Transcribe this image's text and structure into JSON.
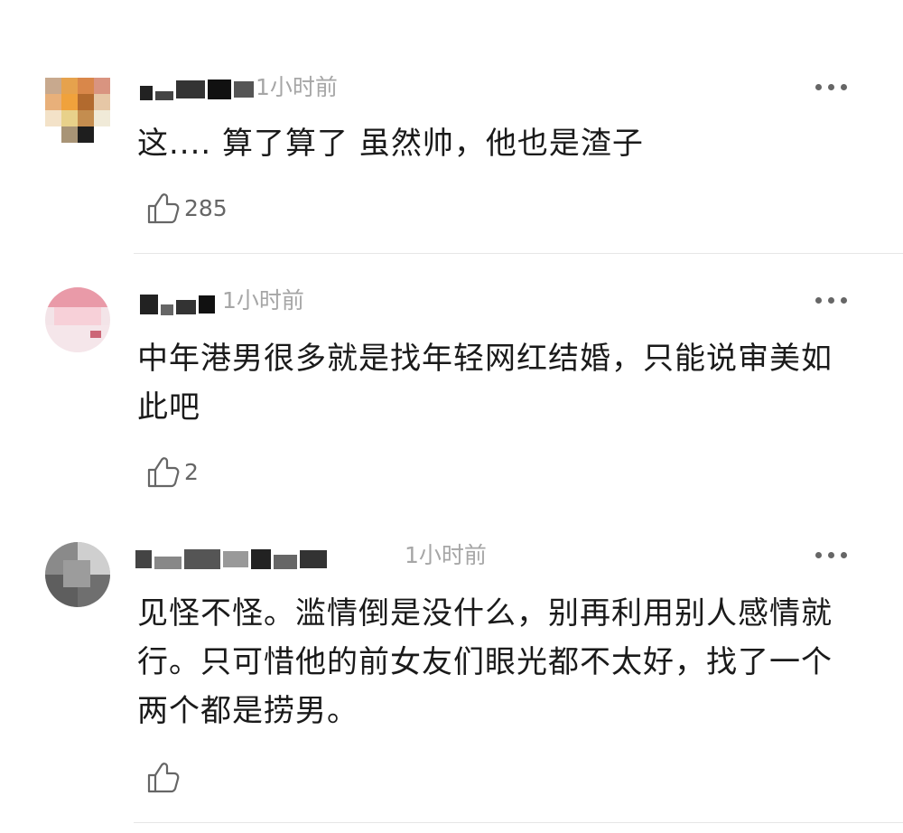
{
  "comments": [
    {
      "time": "1小时前",
      "text": "这.... 算了算了 虽然帅，他也是渣子",
      "likes": "285"
    },
    {
      "time": "1小时前",
      "text": "中年港男很多就是找年轻网红结婚，只能说审美如此吧",
      "likes": "2"
    },
    {
      "time": "1小时前",
      "text": "见怪不怪。滥情倒是没什么，别再利用别人感情就行。只可惜他的前女友们眼光都不太好，找了一个两个都是捞男。",
      "likes": ""
    }
  ],
  "icons": {
    "more": "more-horizontal-icon",
    "like": "thumbs-up-icon"
  },
  "colors": {
    "text": "#1a1a1a",
    "muted": "#a6a6a6",
    "divider": "#e6e6e6"
  }
}
